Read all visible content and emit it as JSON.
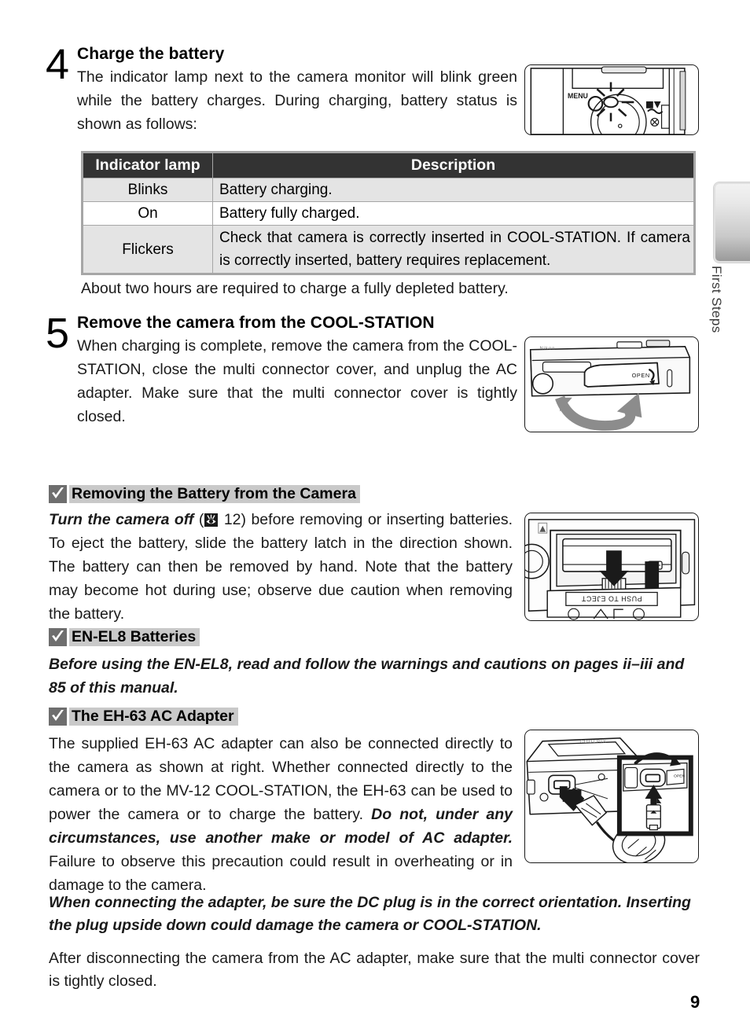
{
  "page": {
    "number": "9",
    "side_tab_label": "First Steps"
  },
  "steps": [
    {
      "number": "4",
      "title": "Charge the battery",
      "body": "The indicator lamp next to the camera monitor will blink green while the battery charges.  During charging, battery status is shown as follows:"
    },
    {
      "number": "5",
      "title": "Remove the camera from the COOL-STATION",
      "body": "When charging is complete, remove the camera from the COOL-STATION, close the multi connector cover, and unplug the AC adapter.  Make sure that the multi connector cover is tightly closed."
    }
  ],
  "table": {
    "headers": [
      "Indicator lamp",
      "Description"
    ],
    "rows": [
      {
        "lamp": "Blinks",
        "description": "Battery charging."
      },
      {
        "lamp": "On",
        "description": "Battery fully charged."
      },
      {
        "lamp": "Flickers",
        "description": "Check that camera is correctly inserted in COOL-STATION.  If camera is correctly inserted, battery requires replacement."
      }
    ]
  },
  "after_table_note": "About two hours are required to charge a fully depleted battery.",
  "notes": [
    {
      "heading": "Removing the Battery from the Camera",
      "lead_italic": "Turn the camera off",
      "ref_page": "12)",
      "body": " before removing or inserting batteries.  To eject the battery, slide the battery latch in the direction shown.  The battery can then be removed by hand.  Note that the battery may become hot during use; observe due caution when removing the battery."
    },
    {
      "heading": "EN-EL8 Batteries",
      "body_italic": "Before using the EN-EL8, read and follow the warnings and cautions on pages ii–iii and 85 of this manual."
    },
    {
      "heading": "The EH-63 AC Adapter",
      "body_part1": "The supplied EH-63 AC adapter can also be connected directly to the camera as shown at right.  Whether connected directly to the camera or to the MV-12 COOL-STATION, the EH-63 can be used to power the camera or to charge the battery.  ",
      "body_emphasis": "Do not, under any circumstances, use another make or model of AC adapter.",
      "body_part2": "  Failure to observe this precaution could result in overheating or in damage to the camera.",
      "warning_italic": "When connecting the adapter, be sure the DC plug is in the correct orientation.  Inserting the plug upside down could damage the camera or COOL-STATION.",
      "closing": "After disconnecting the camera from the AC adapter, make sure that the multi connector cover is tightly closed."
    }
  ],
  "figures": {
    "camera_back": {
      "label_menu": "MENU"
    },
    "cool_station_release": {
      "label_open": "OPEN"
    },
    "battery_compartment": {
      "label_push": "PUSH TO EJECT"
    },
    "ac_adapter": {
      "label_open": "OPEN"
    }
  },
  "colors": {
    "table_header_bg": "#333333",
    "table_row_shaded": "#e4e4e4",
    "table_border": "#a6a6a6",
    "note_heading_bg": "#c9c9c9",
    "check_icon_bg": "#6e6e6e",
    "arrow_gray": "#8c8c8c"
  }
}
